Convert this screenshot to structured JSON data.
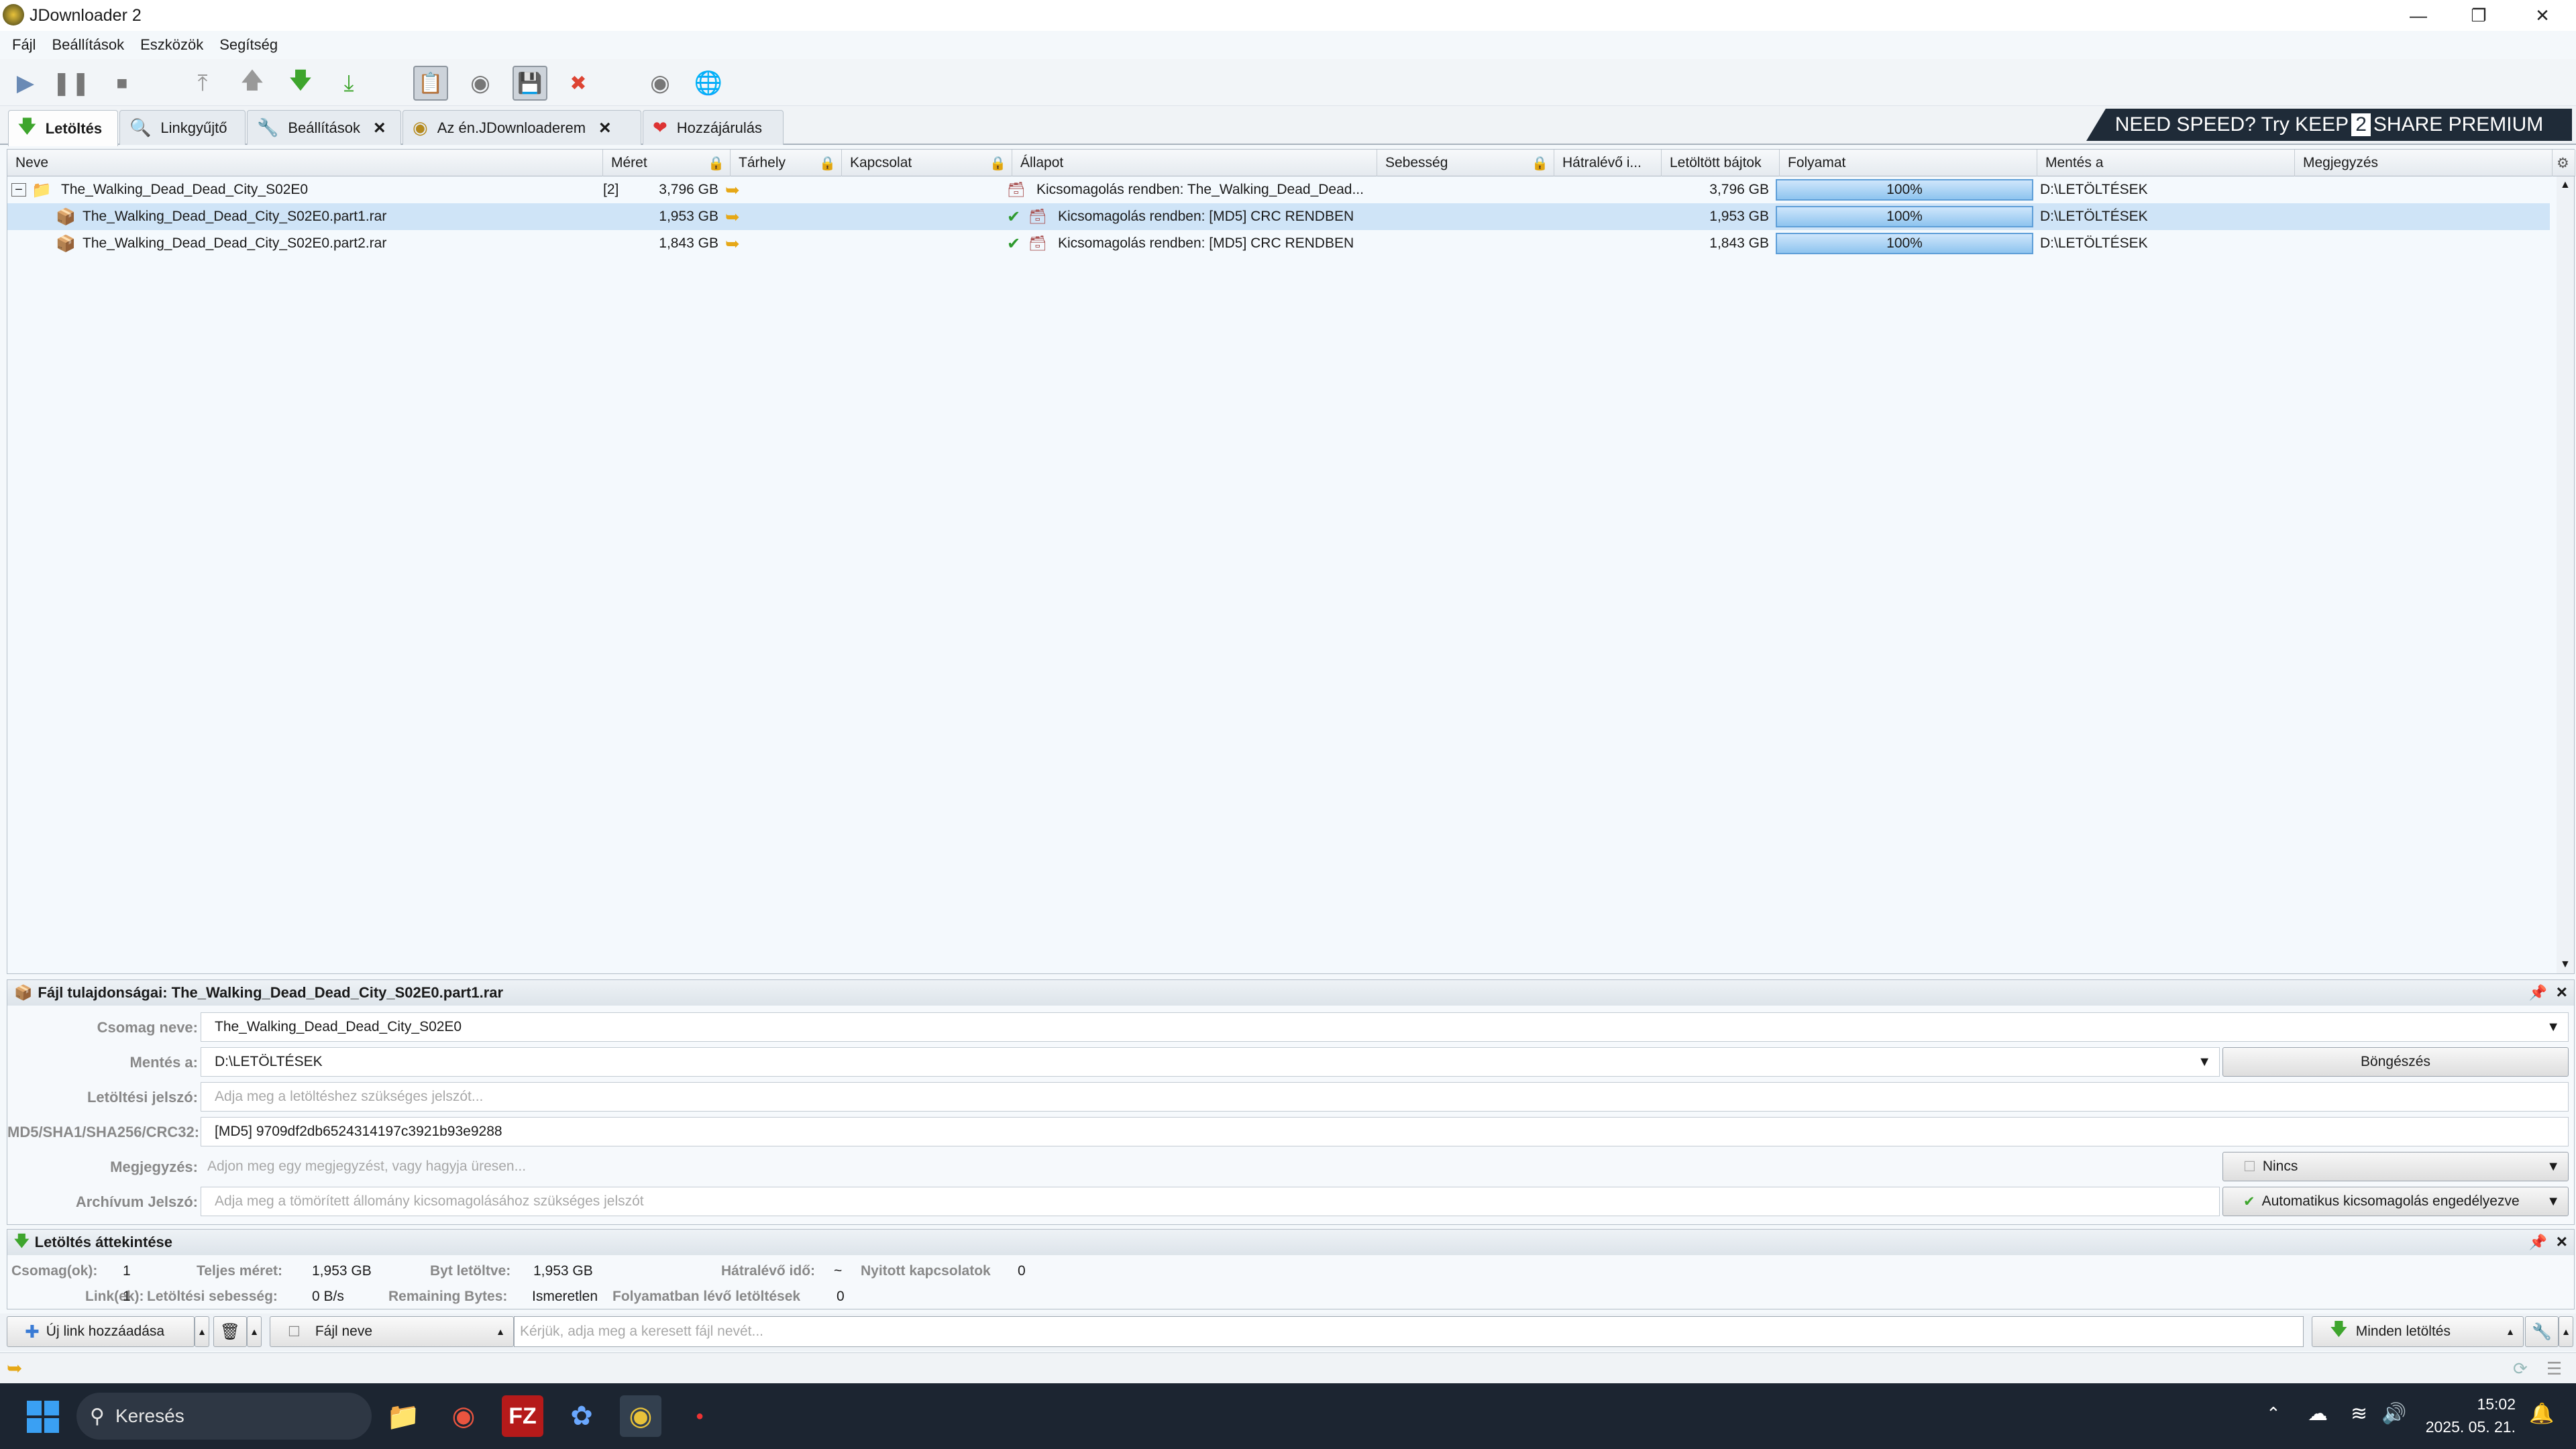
{
  "window": {
    "title": "JDownloader 2"
  },
  "menu": [
    "Fájl",
    "Beállítások",
    "Eszközök",
    "Segítség"
  ],
  "tabs": [
    {
      "label": "Letöltés",
      "active": true,
      "closable": false
    },
    {
      "label": "Linkgyűjtő",
      "active": false,
      "closable": false
    },
    {
      "label": "Beállítások",
      "active": false,
      "closable": true
    },
    {
      "label": "Az én.JDownloaderem",
      "active": false,
      "closable": true
    },
    {
      "label": "Hozzájárulás",
      "active": false,
      "closable": false
    }
  ],
  "banner": {
    "text1": "NEED SPEED? Try ",
    "text2": "KEEP",
    "text3": "2",
    "text4": "SHARE PREMIUM"
  },
  "columns": [
    "Neve",
    "Méret",
    "Tárhely",
    "Kapcsolat",
    "Állapot",
    "Sebesség",
    "Hátralévő i...",
    "Letöltött bájtok",
    "Folyamat",
    "Mentés a",
    "Megjegyzés"
  ],
  "rows": [
    {
      "name": "The_Walking_Dead_Dead_City_S02E0",
      "count": "[2]",
      "size": "3,796 GB",
      "status": "Kicsomagolás rendben: The_Walking_Dead_Dead...",
      "downloaded": "3,796 GB",
      "progress_label": "100%",
      "progress": 1.0,
      "save_to": "D:\\LETÖLTÉSEK",
      "is_package": true,
      "selected": false
    },
    {
      "name": "The_Walking_Dead_Dead_City_S02E0.part1.rar",
      "count": "",
      "size": "1,953 GB",
      "status": "Kicsomagolás rendben: [MD5] CRC RENDBEN",
      "downloaded": "1,953 GB",
      "progress_label": "100%",
      "progress": 1.0,
      "save_to": "D:\\LETÖLTÉSEK",
      "is_package": false,
      "selected": true
    },
    {
      "name": "The_Walking_Dead_Dead_City_S02E0.part2.rar",
      "count": "",
      "size": "1,843 GB",
      "status": "Kicsomagolás rendben: [MD5] CRC RENDBEN",
      "downloaded": "1,843 GB",
      "progress_label": "100%",
      "progress": 1.0,
      "save_to": "D:\\LETÖLTÉSEK",
      "is_package": false,
      "selected": false
    }
  ],
  "properties": {
    "title": "Fájl tulajdonságai: The_Walking_Dead_Dead_City_S02E0.part1.rar",
    "package_label": "Csomag neve:",
    "package_value": "The_Walking_Dead_Dead_City_S02E0",
    "save_label": "Mentés a:",
    "save_value": "D:\\LETÖLTÉSEK",
    "browse_button": "Böngészés",
    "password_label": "Letöltési jelszó:",
    "password_placeholder": "Adja meg a letöltéshez szükséges jelszót...",
    "hash_label": "MD5/SHA1/SHA256/CRC32:",
    "hash_value": "[MD5] 9709df2db6524314197c3921b93e9288",
    "comment_label": "Megjegyzés:",
    "comment_placeholder": "Adjon meg egy megjegyzést, vagy hagyja üresen...",
    "priority_value": "Nincs",
    "archive_label": "Archívum Jelszó:",
    "archive_placeholder": "Adja meg a tömörített állomány kicsomagolásához szükséges jelszót",
    "autoextract_value": "Automatikus kicsomagolás engedélyezve"
  },
  "overview": {
    "title": "Letöltés áttekintése",
    "packages_label": "Csomag(ok):",
    "packages_value": "1",
    "total_size_label": "Teljes méret:",
    "total_size_value": "1,953 GB",
    "bytes_loaded_label": "Byt letöltve:",
    "bytes_loaded_value": "1,953 GB",
    "eta_label": "Hátralévő idő:",
    "eta_value": "~",
    "open_conn_label": "Nyitott kapcsolatok",
    "open_conn_value": "0",
    "links_label": "Link(ek):",
    "links_value": "1",
    "speed_label": "Letöltési sebesség:",
    "speed_value": "0 B/s",
    "remaining_label": "Remaining Bytes:",
    "remaining_value": "Ismeretlen",
    "running_label": "Folyamatban lévő letöltések",
    "running_value": "0"
  },
  "bottombar": {
    "add_links": "Új link hozzáadása",
    "filter_label": "Fájl neve",
    "search_placeholder": "Kérjük, adja meg a keresett fájl nevét...",
    "all_downloads": "Minden letöltés"
  },
  "taskbar": {
    "search": "Keresés",
    "time": "15:02",
    "date": "2025. 05. 21."
  }
}
